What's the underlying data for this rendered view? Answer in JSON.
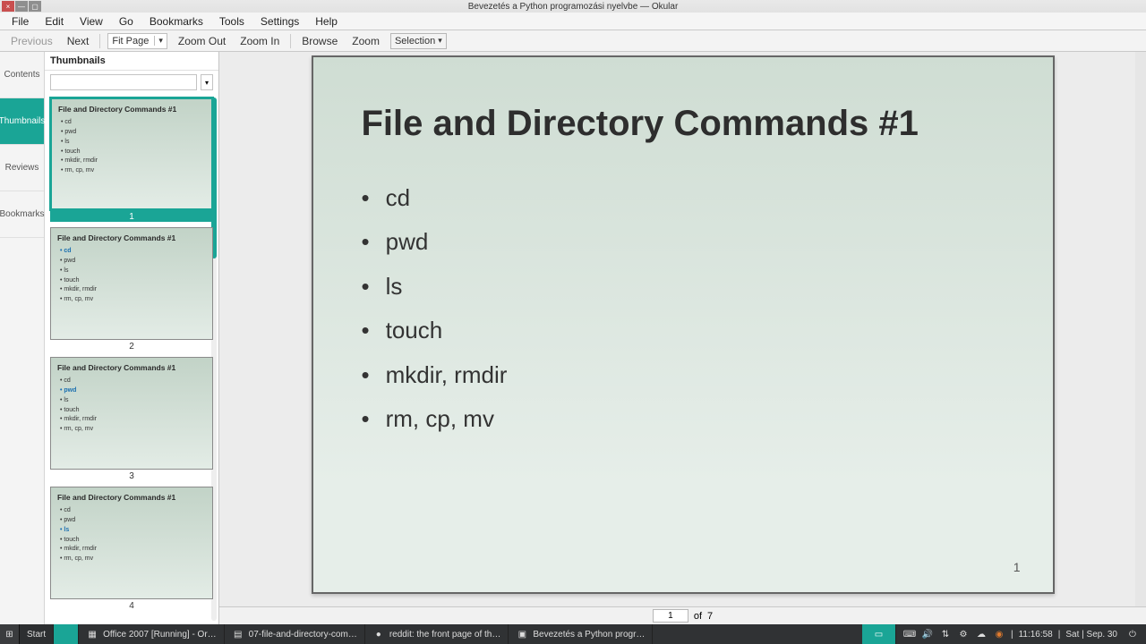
{
  "window": {
    "title": "Bevezetés a Python  programozási nyelvbe — Okular"
  },
  "menubar": [
    "File",
    "Edit",
    "View",
    "Go",
    "Bookmarks",
    "Tools",
    "Settings",
    "Help"
  ],
  "toolbar": {
    "previous": "Previous",
    "next": "Next",
    "fit": "Fit Page",
    "zoom_out": "Zoom Out",
    "zoom_in": "Zoom In",
    "browse": "Browse",
    "zoom": "Zoom",
    "selection": "Selection"
  },
  "sidebar_tabs": {
    "contents": "Contents",
    "thumbnails": "Thumbnails",
    "reviews": "Reviews",
    "bookmarks": "Bookmarks"
  },
  "thumbnails": {
    "header": "Thumbnails",
    "filter_placeholder": "",
    "slides": [
      {
        "title": "File and Directory Commands #1",
        "highlight": -1,
        "num": "1"
      },
      {
        "title": "File and Directory Commands #1",
        "highlight": 0,
        "num": "2"
      },
      {
        "title": "File and Directory Commands #1",
        "highlight": 1,
        "num": "3"
      },
      {
        "title": "File and Directory Commands #1",
        "highlight": 2,
        "num": "4"
      }
    ],
    "bullets": [
      "cd",
      "pwd",
      "ls",
      "touch",
      "mkdir, rmdir",
      "rm, cp, mv"
    ]
  },
  "page": {
    "title": "File and Directory Commands #1",
    "bullets": [
      "cd",
      "pwd",
      "ls",
      "touch",
      "mkdir, rmdir",
      "rm, cp, mv"
    ],
    "page_number": "1"
  },
  "page_nav": {
    "current": "1",
    "of": "of",
    "total": "7"
  },
  "taskbar": {
    "start": "Start",
    "items": [
      "Office 2007 [Running] - Or…",
      "07-file-and-directory-com…",
      "reddit: the front page of th…",
      "Bevezetés a Python  progr…"
    ],
    "clock": "11:16:58",
    "date": "Sat | Sep. 30"
  }
}
